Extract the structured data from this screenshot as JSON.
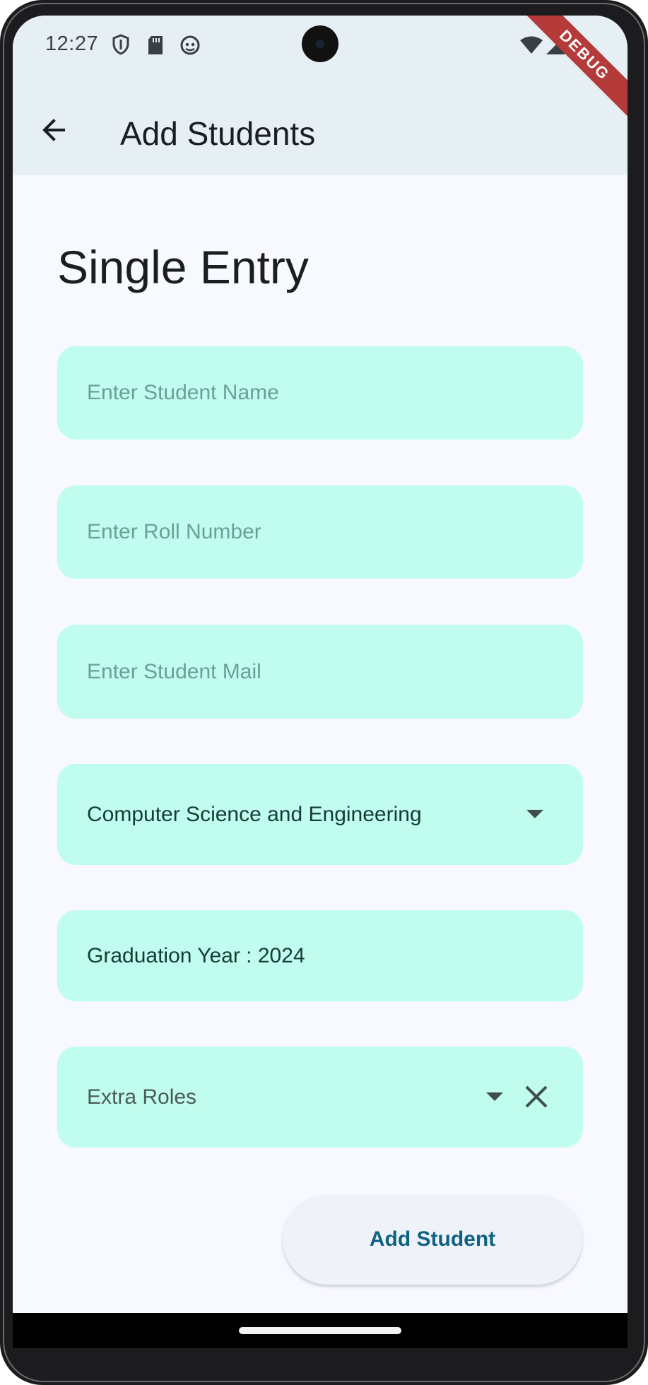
{
  "status_bar": {
    "time": "12:27",
    "left_icons": [
      "shield-icon",
      "sd-card-icon",
      "android-face-icon"
    ],
    "right_icons": [
      "wifi-icon",
      "cell-signal-icon",
      "battery-icon"
    ]
  },
  "debug_banner": "DEBUG",
  "app_bar": {
    "title": "Add Students",
    "back_icon": "arrow-back-icon"
  },
  "form": {
    "section_title": "Single Entry",
    "name_placeholder": "Enter Student Name",
    "roll_placeholder": "Enter Roll Number",
    "mail_placeholder": "Enter Student Mail",
    "department_selected": "Computer Science and Engineering",
    "graduation_year": "Graduation Year : 2024",
    "extra_roles_placeholder": "Extra Roles",
    "submit_label": "Add Student"
  },
  "colors": {
    "field_background": "#c0fdee",
    "app_bar_background": "#e6eff4",
    "page_background": "#f8f9ff",
    "button_text": "#0f6182"
  }
}
